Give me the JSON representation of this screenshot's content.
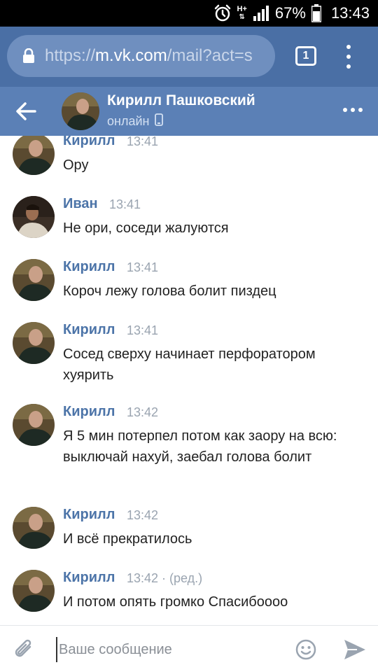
{
  "status_bar": {
    "network": "H+",
    "battery_pct": "67%",
    "time": "13:43",
    "icons": [
      "alarm-icon",
      "signal-icon",
      "battery-icon"
    ]
  },
  "browser": {
    "url_scheme": "https://",
    "url_host": "m.vk.com",
    "url_path": "/mail?act=s",
    "tab_count": "1",
    "icons": [
      "lock-icon",
      "tabs-icon",
      "overflow-menu-icon"
    ]
  },
  "chat": {
    "contact_name": "Кирилл Пашковский",
    "status": "онлайн",
    "icons": [
      "back-arrow-icon",
      "mobile-phone-icon",
      "more-icon"
    ]
  },
  "messages": [
    {
      "author": "Кирилл",
      "time": "13:41",
      "text": "Ору",
      "edited": ""
    },
    {
      "author": "Иван",
      "time": "13:41",
      "text": "Не ори, соседи жалуются",
      "edited": ""
    },
    {
      "author": "Кирилл",
      "time": "13:41",
      "text": "Короч лежу голова болит пиздец",
      "edited": ""
    },
    {
      "author": "Кирилл",
      "time": "13:41",
      "text": "Сосед сверху начинает перфоратором хуярить",
      "edited": ""
    },
    {
      "author": "Кирилл",
      "time": "13:42",
      "text": "Я 5 мин потерпел потом как заору на всю: выключай нахуй, заебал голова болит",
      "edited": ""
    },
    {
      "author": "Кирилл",
      "time": "13:42",
      "text": "И всё прекратилось",
      "edited": ""
    },
    {
      "author": "Кирилл",
      "time": "13:42",
      "text": "И потом опять громко Спасибоооо",
      "edited": " · (ред.)"
    }
  ],
  "composer": {
    "placeholder": "Ваше сообщение",
    "value": "",
    "icons": [
      "paperclip-icon",
      "smiley-icon",
      "send-icon"
    ]
  },
  "colors": {
    "browser_bar": "#4a6fa5",
    "chat_header": "#5b80b6",
    "author_name": "#4c74a8",
    "timestamp": "#9aa4b0"
  }
}
